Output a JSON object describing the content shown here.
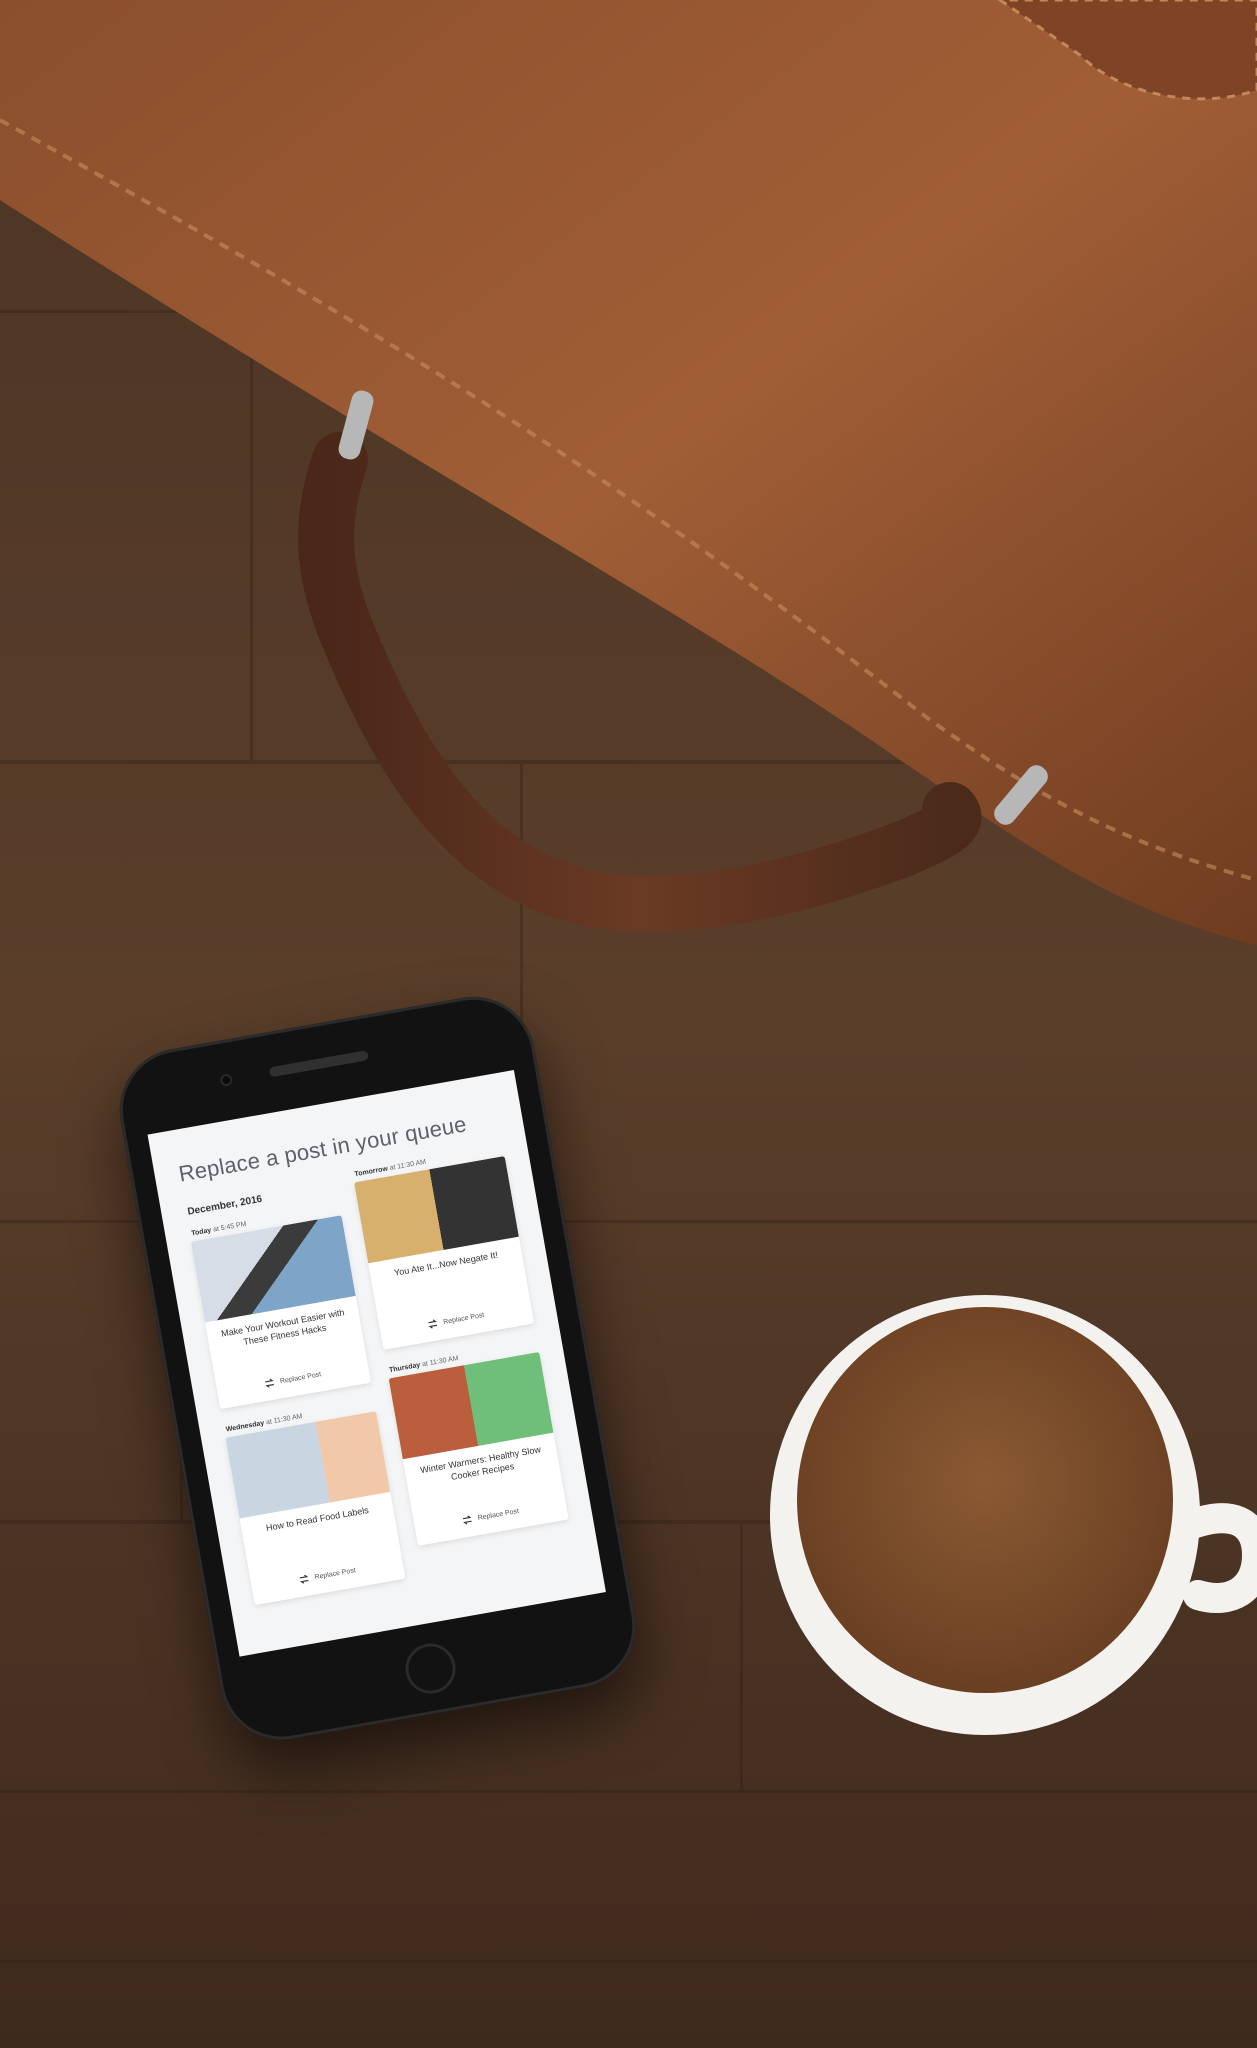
{
  "screen": {
    "title": "Replace a post in your queue",
    "month": "December, 2016"
  },
  "cards": [
    {
      "day": "Today",
      "at": "at 5:45 PM",
      "title": "Make Your Workout Easier with These Fitness Hacks",
      "button_label": "Replace Post",
      "icon": "swap-arrows-icon"
    },
    {
      "day": "Tomorrow",
      "at": "at 11:30 AM",
      "title": "You Ate It...Now Negate It!",
      "button_label": "Replace Post",
      "icon": "swap-arrows-icon"
    },
    {
      "day": "Wednesday",
      "at": "at 11:30 AM",
      "title": "How to Read Food Labels",
      "button_label": "Replace Post",
      "icon": "swap-arrows-icon"
    },
    {
      "day": "Thursday",
      "at": "at 11:30 AM",
      "title": "Winter Warmers: Healthy Slow Cooker Recipes",
      "button_label": "Replace Post",
      "icon": "swap-arrows-icon"
    }
  ]
}
